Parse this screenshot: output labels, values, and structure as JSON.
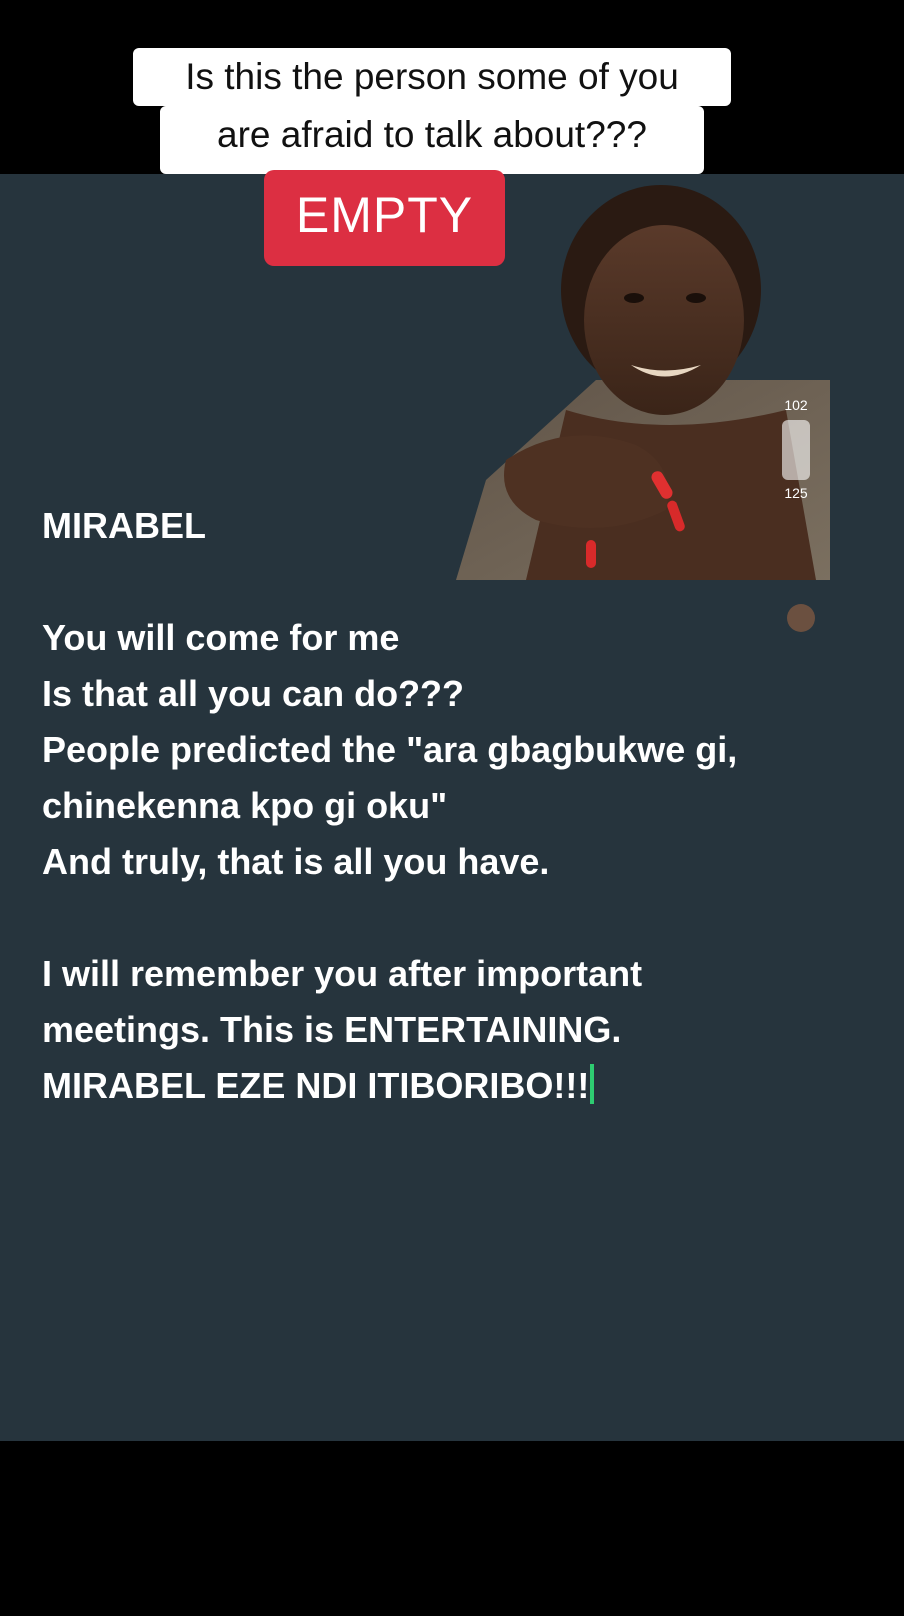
{
  "caption": {
    "line1": "Is this the person some of you",
    "line2": "are afraid to talk about???"
  },
  "badge": {
    "label": "EMPTY",
    "color": "#dc2f42"
  },
  "photo": {
    "overlay_number_1": "102",
    "overlay_number_2": "125"
  },
  "post": {
    "title": "MIRABEL",
    "lines": [
      "You will come for me",
      "Is that all you can do???",
      "People predicted the \"ara gbagbukwe gi,",
      "chinekenna kpo gi oku\"",
      "And truly, that is all you have."
    ],
    "closing": [
      "I will remember you after important",
      "meetings. This is ENTERTAINING.",
      "MIRABEL EZE NDI ITIBORIBO!!!"
    ]
  },
  "colors": {
    "background": "#26343d",
    "text": "#ffffff",
    "cursor": "#2ecc71"
  }
}
